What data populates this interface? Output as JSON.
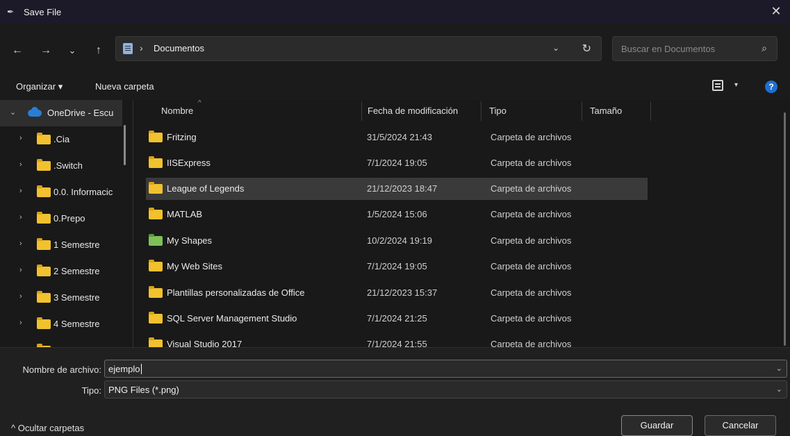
{
  "window": {
    "title": "Save File",
    "close_glyph": "✕"
  },
  "nav": {
    "back": "←",
    "forward": "→",
    "recent": "⌄",
    "up": "↑",
    "path_separator": "›",
    "path": "Documentos",
    "path_dropdown": "⌄",
    "refresh": "↻",
    "search_placeholder": "Buscar en Documentos",
    "search_icon": "⌕"
  },
  "toolbar": {
    "organize_label": "Organizar ▾",
    "new_folder_label": "Nueva carpeta",
    "view_dropdown": "▾",
    "help_glyph": "?"
  },
  "sidebar": {
    "onedrive_label": "OneDrive - Escu",
    "items": [
      {
        "label": ".Cia"
      },
      {
        "label": ".Switch"
      },
      {
        "label": "0.0. Informacic"
      },
      {
        "label": "0.Prepo"
      },
      {
        "label": "1 Semestre"
      },
      {
        "label": "2 Semestre"
      },
      {
        "label": "3 Semestre"
      },
      {
        "label": "4 Semestre"
      }
    ],
    "chevron_collapsed": "›",
    "chevron_expanded": "⌄"
  },
  "columns": {
    "name": "Nombre",
    "modified": "Fecha de modificación",
    "type": "Tipo",
    "size": "Tamaño",
    "sort_arrow": "^"
  },
  "files": [
    {
      "name": "Fritzing",
      "date": "31/5/2024 21:43",
      "type": "Carpeta de archivos",
      "icon": "folder-icon"
    },
    {
      "name": "IISExpress",
      "date": "7/1/2024 19:05",
      "type": "Carpeta de archivos",
      "icon": "folder-icon"
    },
    {
      "name": "League of Legends",
      "date": "21/12/2023 18:47",
      "type": "Carpeta de archivos",
      "icon": "folder-icon",
      "selected": true
    },
    {
      "name": "MATLAB",
      "date": "1/5/2024 15:06",
      "type": "Carpeta de archivos",
      "icon": "folder-icon"
    },
    {
      "name": "My Shapes",
      "date": "10/2/2024 19:19",
      "type": "Carpeta de archivos",
      "icon": "visio-folder-icon"
    },
    {
      "name": "My Web Sites",
      "date": "7/1/2024 19:05",
      "type": "Carpeta de archivos",
      "icon": "folder-icon"
    },
    {
      "name": "Plantillas personalizadas de Office",
      "date": "21/12/2023 15:37",
      "type": "Carpeta de archivos",
      "icon": "folder-icon"
    },
    {
      "name": "SQL Server Management Studio",
      "date": "7/1/2024 21:25",
      "type": "Carpeta de archivos",
      "icon": "folder-icon"
    },
    {
      "name": "Visual Studio 2017",
      "date": "7/1/2024 21:55",
      "type": "Carpeta de archivos",
      "icon": "folder-icon"
    }
  ],
  "form": {
    "filename_label": "Nombre de archivo:",
    "filename_value": "ejemplo",
    "type_label": "Tipo:",
    "type_value": "PNG Files (*.png)",
    "dropdown_glyph": "⌄"
  },
  "footer": {
    "hide_folders_label": "^ Ocultar carpetas",
    "save_label": "Guardar",
    "cancel_label": "Cancelar"
  },
  "colors": {
    "accent": "#1f6fd0",
    "folder": "#f2c12e",
    "selected_row": "#3a3a3a"
  }
}
